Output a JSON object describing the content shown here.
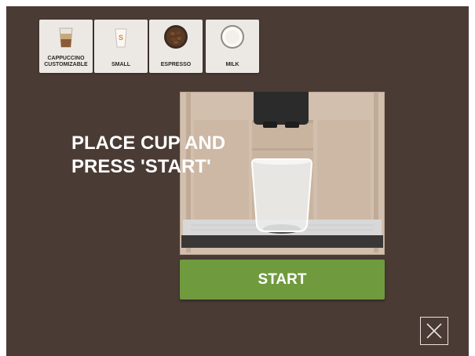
{
  "options": [
    {
      "label_line1": "CAPPUCCINO",
      "label_line2": "CUSTOMIZABLE",
      "icon": "cappuccino-glass-icon"
    },
    {
      "label_line1": "SMALL",
      "label_line2": "",
      "icon": "small-cup-icon"
    },
    {
      "label_line1": "ESPRESSO",
      "label_line2": "",
      "icon": "coffee-beans-icon"
    },
    {
      "label_line1": "MILK",
      "label_line2": "",
      "icon": "milk-icon"
    }
  ],
  "small_cup_badge": "S",
  "instruction": {
    "line1": "PLACE CUP AND",
    "line2": "PRESS 'START'"
  },
  "start_label": "START",
  "close_icon": "close-icon",
  "colors": {
    "background": "#4a3b35",
    "start_button": "#6f9a3d",
    "tile": "#ece9e5"
  }
}
